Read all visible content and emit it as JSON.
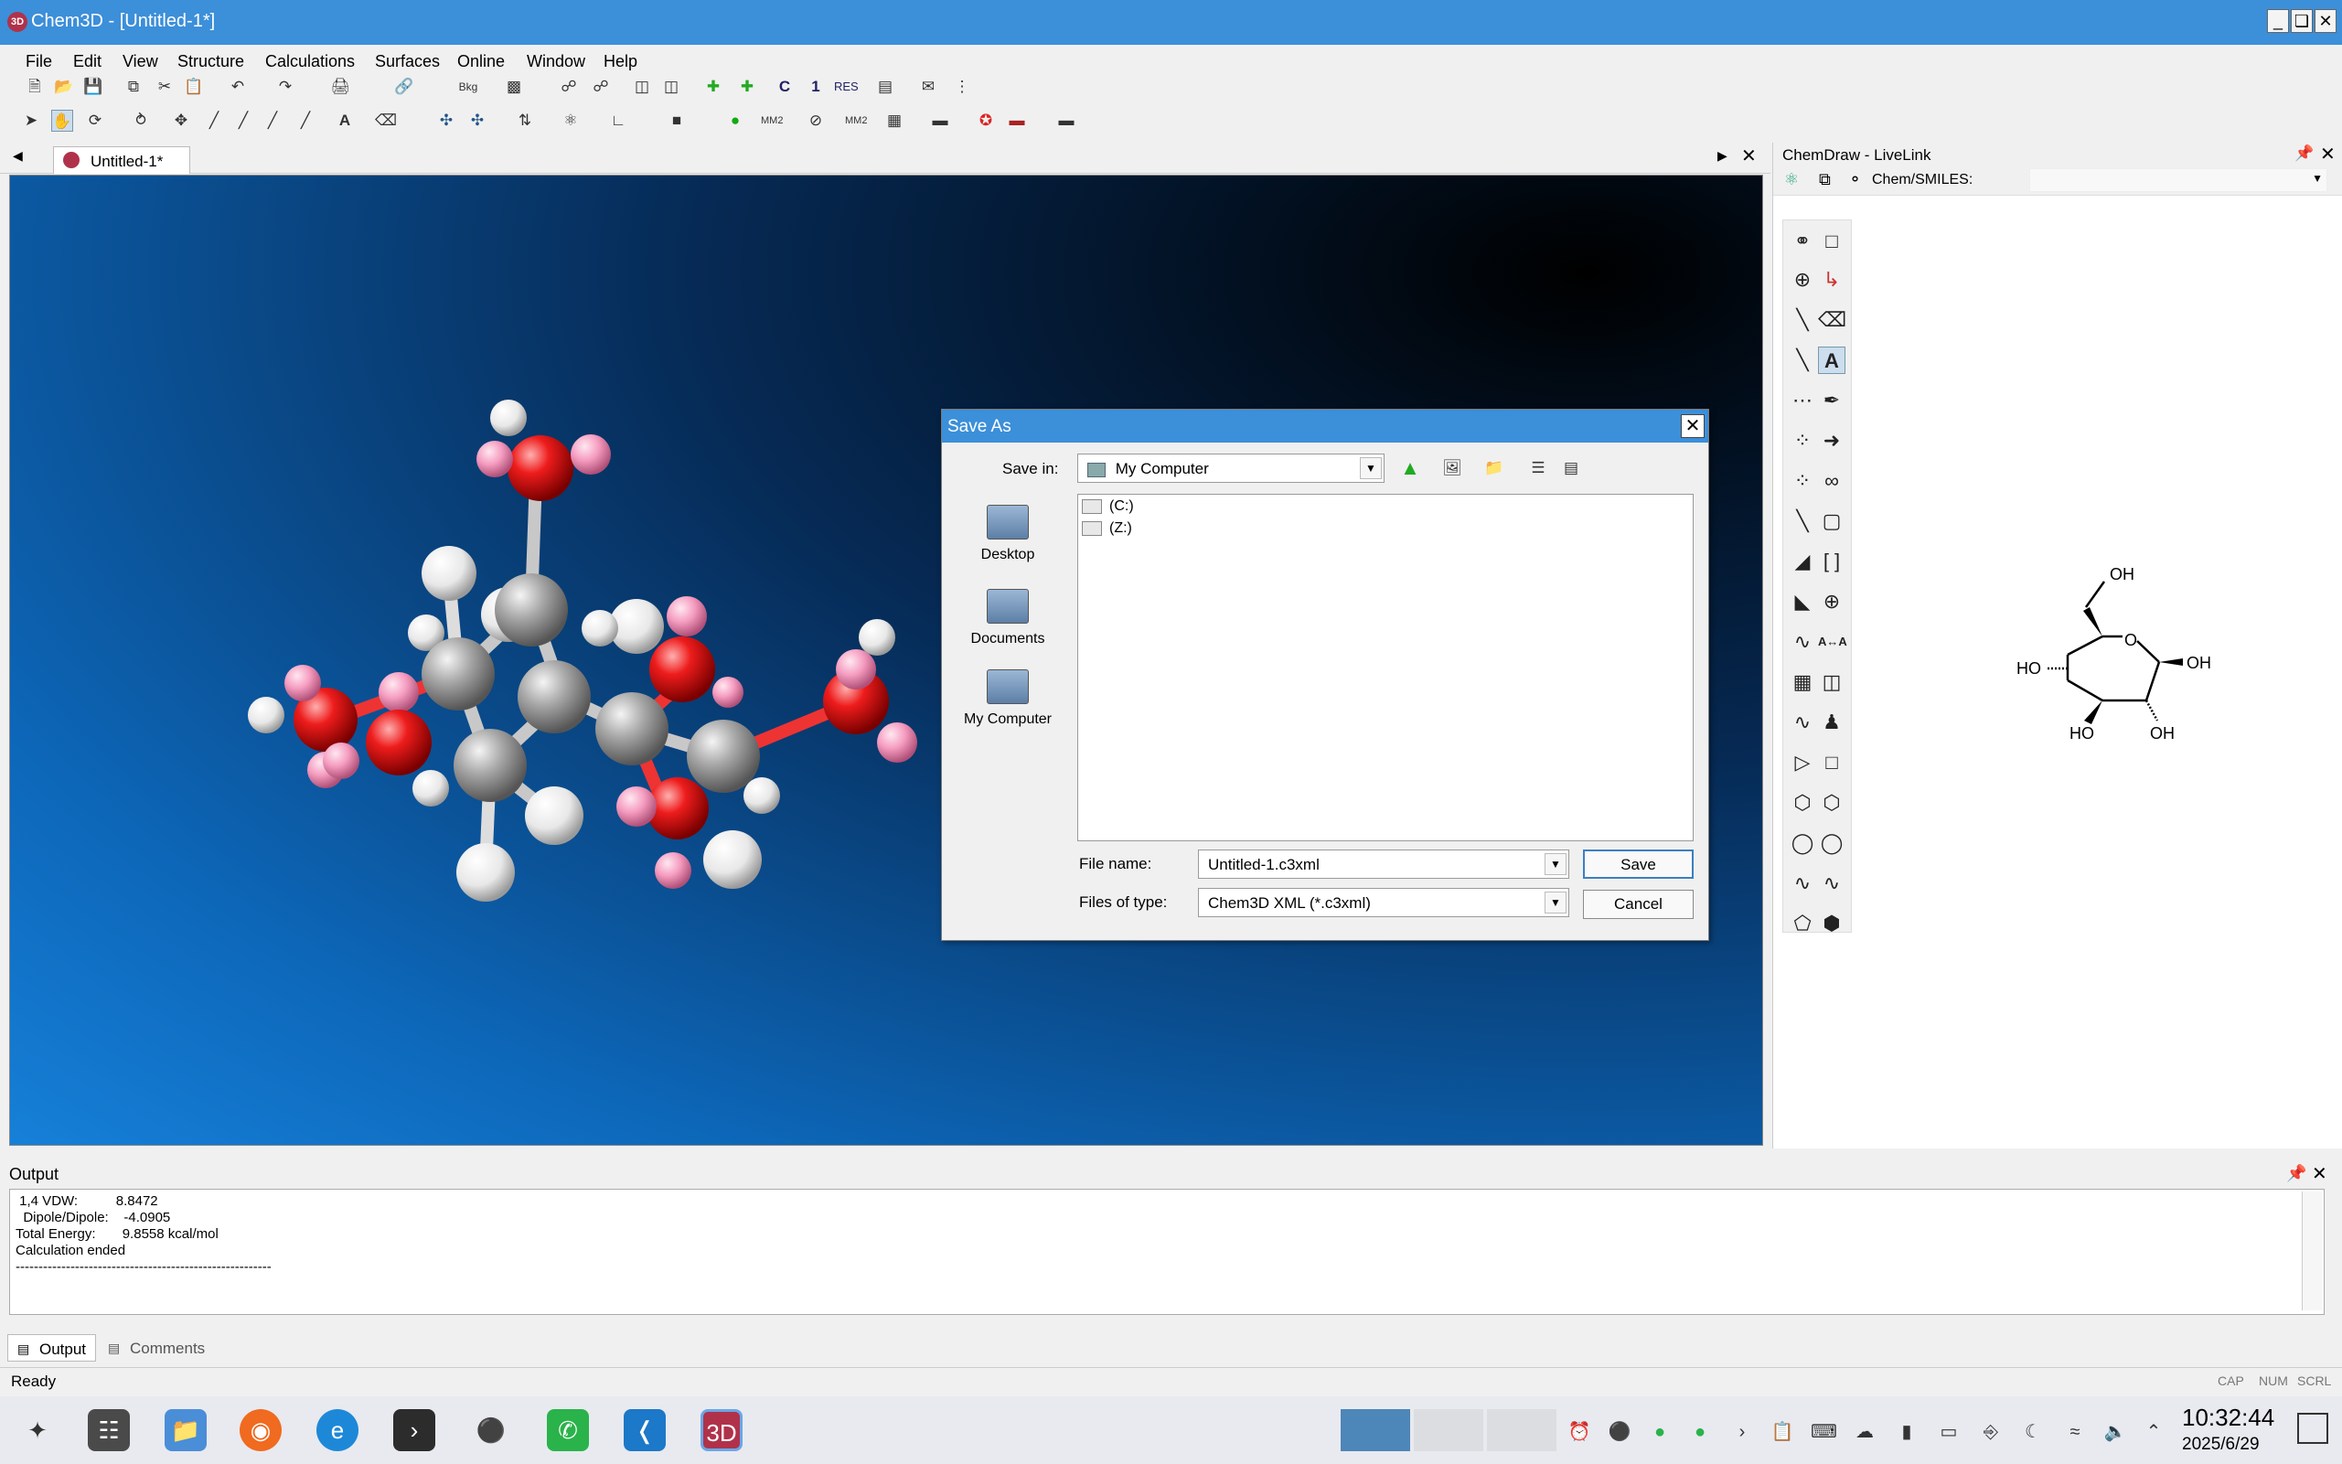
{
  "window": {
    "title": "Chem3D - [Untitled-1*]",
    "app_icon": "3D"
  },
  "menu": [
    "File",
    "Edit",
    "View",
    "Structure",
    "Calculations",
    "Surfaces",
    "Online",
    "Window",
    "Help"
  ],
  "toolbar": {
    "bkg_label": "Bkg",
    "c_label": "C",
    "one_label": "1",
    "res_label": "RES",
    "mm2_label": "MM2",
    "mm2_label2": "MM2",
    "text_tool": "A"
  },
  "document": {
    "tab_label": "Untitled-1*"
  },
  "livelink": {
    "title": "ChemDraw - LiveLink",
    "smiles_label": "Chem/SMILES:",
    "smiles_value": "",
    "atom_map_label": "A↔A",
    "structure_labels": {
      "oh_top": "OH",
      "o_ring": "O",
      "ho_left": "HO",
      "oh_right": "OH",
      "ho_bottom": "HO",
      "oh_bottom": "OH"
    }
  },
  "dialog": {
    "title": "Save As",
    "save_in_label": "Save in:",
    "save_in_value": "My Computer",
    "places": [
      "Desktop",
      "Documents",
      "My Computer"
    ],
    "drives": [
      "(C:)",
      "(Z:)"
    ],
    "file_name_label": "File name:",
    "file_name_value": "Untitled-1.c3xml",
    "file_type_label": "Files of type:",
    "file_type_value": "Chem3D XML (*.c3xml)",
    "save_button": "Save",
    "cancel_button": "Cancel"
  },
  "output": {
    "title": "Output",
    "lines": [
      " 1,4 VDW:          8.8472",
      "  Dipole/Dipole:    -4.0905",
      "Total Energy:       9.8558 kcal/mol",
      "Calculation ended",
      "--------------------------------------------------------"
    ],
    "tabs": [
      "Output",
      "Comments"
    ]
  },
  "status": {
    "text": "Ready",
    "indicators": [
      "CAP",
      "NUM",
      "SCRL"
    ]
  },
  "taskbar": {
    "time": "10:32:44",
    "date": "2025/6/29",
    "apps": [
      "launcher-icon",
      "settings-icon",
      "file-manager-icon",
      "firefox-icon",
      "edge-icon",
      "terminal-icon",
      "qq-icon",
      "wechat-icon",
      "vscode-icon",
      "chem3d-icon"
    ]
  }
}
